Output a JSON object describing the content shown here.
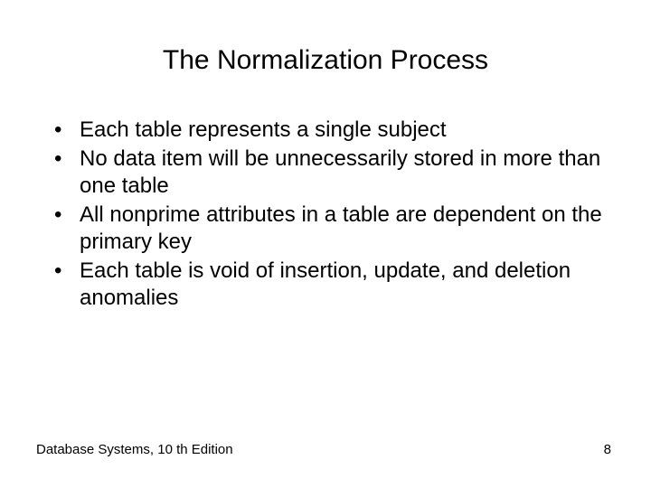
{
  "title": "The Normalization Process",
  "bullets": [
    "Each table represents a single subject",
    "No data item will be unnecessarily stored in more than one table",
    "All nonprime attributes in a table are dependent on the primary key",
    "Each table is void of insertion, update, and deletion anomalies"
  ],
  "footer": {
    "left": "Database Systems, 10 th Edition",
    "right": "8"
  }
}
